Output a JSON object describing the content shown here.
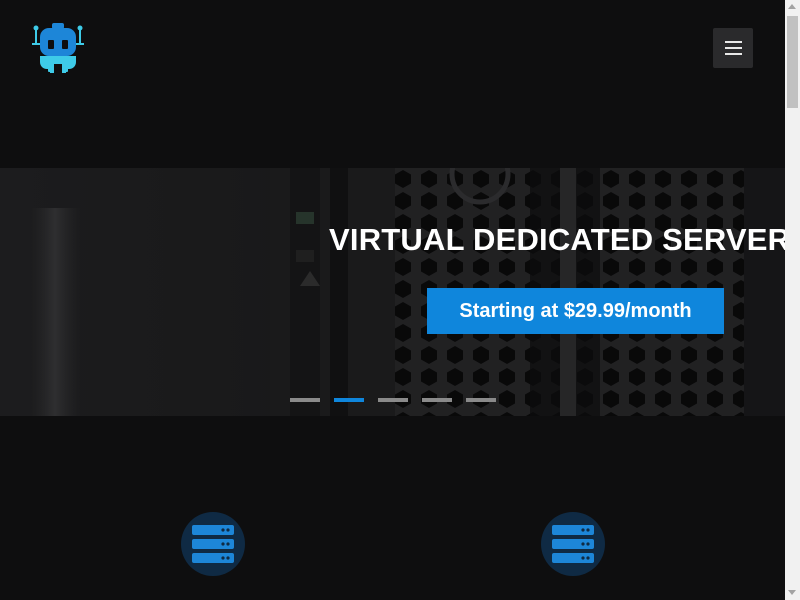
{
  "header": {
    "logo_icon": "robot-logo-icon",
    "menu_icon": "hamburger-menu-icon"
  },
  "hero": {
    "title": "VIRTUAL DEDICATED SERVER",
    "cta_label": "Starting at $29.99/month",
    "slide_count": 5,
    "active_slide": 2
  },
  "features": {
    "items": [
      {
        "icon": "server-stack-icon"
      },
      {
        "icon": "server-stack-icon"
      }
    ]
  },
  "colors": {
    "accent": "#0f86dc",
    "background": "#0e0e0f",
    "icon_circle": "#0f2a44",
    "logo_light": "#3ecbe8",
    "logo_dark": "#1d86d8"
  }
}
